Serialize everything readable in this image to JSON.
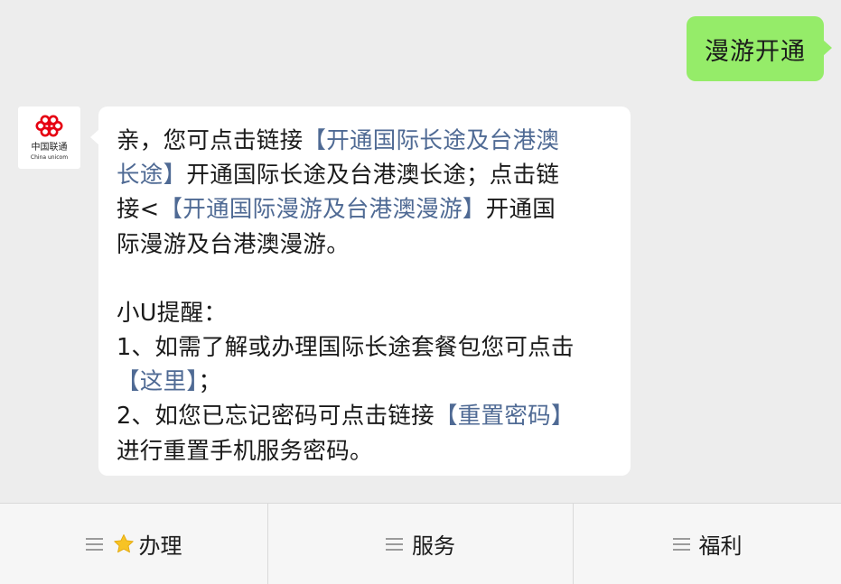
{
  "colors": {
    "user_bubble": "#95ec69",
    "link": "#4f6a94",
    "background": "#ededed",
    "star": "#f7c325",
    "logo_red": "#e60012"
  },
  "user_message": "漫游开通",
  "avatar": {
    "brand_cn": "中国联通",
    "brand_en": "China unicom"
  },
  "bot_message": {
    "l1_pre": "亲，您可点击链接",
    "link1_part1": "【开通国际长途及台港澳",
    "link1_part2": "长途】",
    "l2_post": "开通国际长途及台港澳长途；点击链",
    "l3_pre": "接<",
    "link2": "【开通国际漫游及台港澳漫游】",
    "l3_post": "开通国",
    "l4": "际漫游及台港澳漫游。",
    "reminder_title": "小U提醒：",
    "item1": "1、如需了解或办理国际长途套餐包您可点击",
    "link3": "【这里】",
    "item1_post": "；",
    "item2_pre": "2、如您已忘记密码可点击链接",
    "link4": "【重置密码】",
    "item2_post": "进行重置手机服务密码。"
  },
  "menu": [
    {
      "label": "办理",
      "icon": "star-icon"
    },
    {
      "label": "服务"
    },
    {
      "label": "福利"
    }
  ]
}
